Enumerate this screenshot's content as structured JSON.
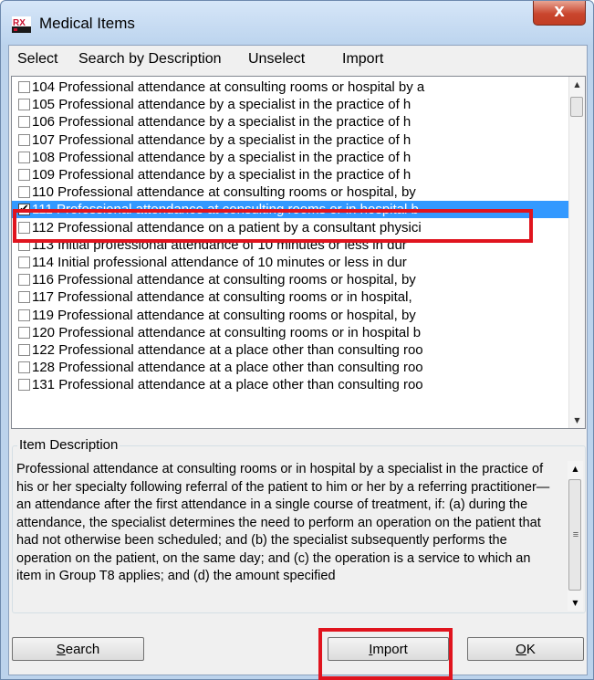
{
  "window": {
    "title": "Medical Items",
    "close_symbol": "X"
  },
  "menu": [
    "Select",
    "Search by Description",
    "Unselect",
    "Import"
  ],
  "items": [
    {
      "label": "104 Professional attendance at consulting rooms or hospital by a",
      "checked": false
    },
    {
      "label": "105 Professional attendance by a specialist in the practice of h",
      "checked": false
    },
    {
      "label": "106 Professional attendance by a specialist in the practice of h",
      "checked": false
    },
    {
      "label": "107 Professional attendance by a specialist in the practice of h",
      "checked": false
    },
    {
      "label": "108 Professional attendance by a specialist in the practice of h",
      "checked": false
    },
    {
      "label": "109 Professional attendance by a specialist in the practice of h",
      "checked": false
    },
    {
      "label": "110 Professional attendance at consulting rooms or hospital, by",
      "checked": false
    },
    {
      "label": "111 Professional attendance at consulting rooms or in hospital b",
      "checked": true,
      "selected": true
    },
    {
      "label": "112 Professional attendance on a patient by a consultant physici",
      "checked": false
    },
    {
      "label": "113 Initial professional attendance of 10 minutes or less in dur",
      "checked": false
    },
    {
      "label": "114 Initial professional attendance of 10 minutes or less in dur",
      "checked": false
    },
    {
      "label": "116 Professional attendance at consulting rooms or hospital, by",
      "checked": false
    },
    {
      "label": "117 Professional attendance at consulting rooms or in hospital,",
      "checked": false
    },
    {
      "label": "119 Professional attendance at consulting rooms or hospital, by",
      "checked": false
    },
    {
      "label": "120 Professional attendance at consulting rooms or in hospital b",
      "checked": false
    },
    {
      "label": "122 Professional attendance at a place other than consulting roo",
      "checked": false
    },
    {
      "label": "128 Professional attendance at a place other than consulting roo",
      "checked": false
    },
    {
      "label": "131 Professional attendance at a place other than consulting roo",
      "checked": false
    }
  ],
  "description": {
    "legend": "Item Description",
    "text": "Professional attendance at consulting rooms or in hospital by a specialist in the practice of his or her specialty following referral of the patient to him or her by a referring practitioner—an attendance after the first attendance in a single course of treatment, if: (a) during the attendance, the specialist determines the need to perform an operation on the patient that had not otherwise been scheduled; and (b) the specialist subsequently performs the operation on the patient, on the same day; and (c) the operation is a service to which an item in Group T8 applies; and (d) the amount specified"
  },
  "buttons": {
    "search": {
      "mnemonic": "S",
      "rest": "earch"
    },
    "import": {
      "mnemonic": "I",
      "rest": "mport"
    },
    "ok": {
      "mnemonic": "O",
      "rest": "K"
    }
  },
  "scroll": {
    "items_position": 0.0,
    "description_position": 0.0
  },
  "colors": {
    "selection": "#3399ff",
    "highlight_box": "#e0141e",
    "title_bar": "#bcd4ee"
  },
  "icons": [
    "rx-app-icon",
    "close-icon",
    "checkbox-icon",
    "scroll-up-arrow-icon",
    "scroll-down-arrow-icon"
  ]
}
